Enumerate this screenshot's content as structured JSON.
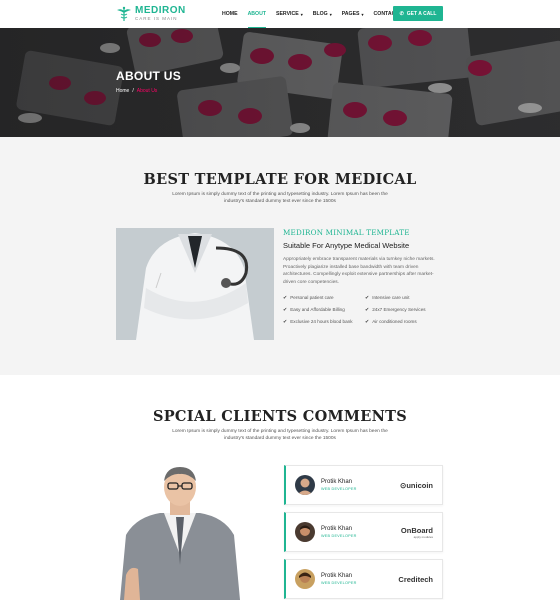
{
  "brand": {
    "name": "MEDIRON",
    "tagline": "CARE IS MAIN",
    "accent": "#1fb592"
  },
  "nav": {
    "items": [
      {
        "label": "HOME",
        "icon": ""
      },
      {
        "label": "ABOUT",
        "icon": ""
      },
      {
        "label": "SERVICE",
        "icon": "chevron-down-icon"
      },
      {
        "label": "BLOG",
        "icon": "chevron-down-icon"
      },
      {
        "label": "PAGES",
        "icon": "chevron-down-icon"
      },
      {
        "label": "CONTACT",
        "icon": ""
      }
    ],
    "active_label": "ABOUT",
    "cta_label": "GET A CALL",
    "cta_icon": "phone-icon"
  },
  "hero": {
    "title": "ABOUT US",
    "breadcrumb_home": "Home",
    "breadcrumb_sep": "/",
    "breadcrumb_current": "About Us"
  },
  "section1": {
    "title": "BEST TEMPLATE FOR MEDICAL",
    "subtitle": "Lorem Ipsum is simply dummy text of the printing and typesetting industry. Lorem Ipsum has been the industry's standard dummy text ever since the 1500s",
    "info_title": "MEDIRON MINIMAL TEMPLATE",
    "info_subtitle": "Suitable For Anytype Medical Website",
    "info_text": "Appropriately embrace transparent materials via turnkey niche markets. Proactively plagiarize installed base bandwidth with team driven architectures. Compellingly exploit extensive partnerships after market-driven core competencies.",
    "features": [
      "Personal patient care",
      "Intensive care unit",
      "Easy and Affordable Billing",
      "24x7 Emergency Services",
      "Exclusive 24 hours blood bank",
      "Air conditioned rooms"
    ]
  },
  "section2": {
    "title": "SPCIAL CLIENTS COMMENTS",
    "subtitle": "Lorem Ipsum is simply dummy text of the printing and typesetting industry. Lorem Ipsum has been the industry's standard dummy text ever since the 1500s",
    "clients": [
      {
        "name": "Protik Khan",
        "role": "WEB DEVELOPER",
        "brand": "unicoin",
        "brand_icon": "unicoin-logo-icon"
      },
      {
        "name": "Protik Khan",
        "role": "WEB DEVELOPER",
        "brand": "OnBoard",
        "brand_tag": "apply modules",
        "brand_icon": "onboard-logo-icon"
      },
      {
        "name": "Protik Khan",
        "role": "WEB DEVELOPER",
        "brand": "Creditech",
        "brand_icon": "creditech-logo-icon"
      }
    ]
  }
}
